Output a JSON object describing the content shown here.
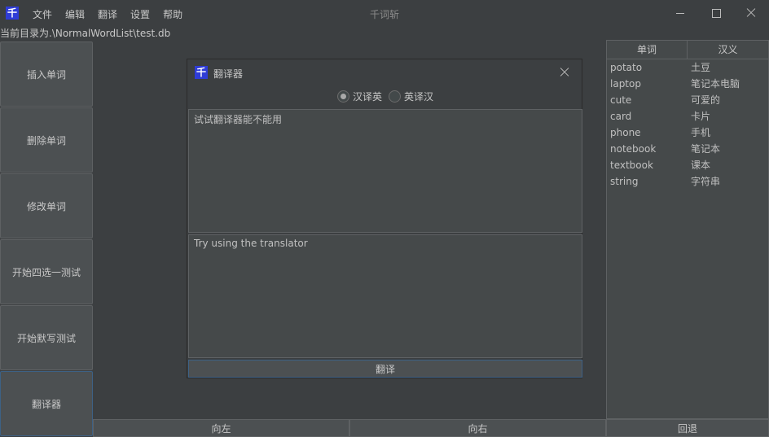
{
  "app": {
    "icon_glyph": "千",
    "window_title": "千词斩",
    "menu": [
      "文件",
      "编辑",
      "翻译",
      "设置",
      "帮助"
    ],
    "current_dir": "当前目录为.\\NormalWordList\\test.db"
  },
  "sidebar": {
    "buttons": [
      "插入单词",
      "删除单词",
      "修改单词",
      "开始四选一测试",
      "开始默写测试",
      "翻译器"
    ]
  },
  "bottom": {
    "left": "向左",
    "right": "向右",
    "back": "回退"
  },
  "table": {
    "headers": [
      "单词",
      "汉义"
    ],
    "rows": [
      [
        "potato",
        "土豆"
      ],
      [
        "laptop",
        "笔记本电脑"
      ],
      [
        "cute",
        "可爱的"
      ],
      [
        "card",
        "卡片"
      ],
      [
        "phone",
        "手机"
      ],
      [
        "notebook",
        "笔记本"
      ],
      [
        "textbook",
        "课本"
      ],
      [
        "string",
        "字符串"
      ]
    ]
  },
  "dialog": {
    "icon_glyph": "千",
    "title": "翻译器",
    "radio_cn_en": "汉译英",
    "radio_en_cn": "英译汉",
    "selected": "汉译英",
    "input_text": "试试翻译器能不能用",
    "output_text": "Try using the translator",
    "translate_label": "翻译"
  },
  "colors": {
    "background": "#3c3f41",
    "panel": "#45494a",
    "button": "#4c5052",
    "focus_border": "#3d6185",
    "icon_blue": "#2f3cd6"
  }
}
